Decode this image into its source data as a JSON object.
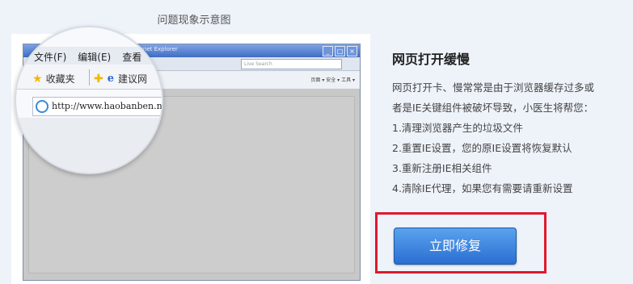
{
  "preview": {
    "caption": "问题现象示意图",
    "ie_title": "ws Internet Explorer",
    "search_placeholder": "Live Search",
    "toolbar_tools": "页面 ▾  安全 ▾  工具 ▾",
    "magnifier": {
      "menu_file": "文件(F)",
      "menu_edit": "编辑(E)",
      "menu_view": "查看",
      "favorites_label": "收藏夹",
      "suggest_label": "建议网",
      "url": "http://www.haobanben.ne"
    }
  },
  "panel": {
    "title": "网页打开缓慢",
    "description": [
      "网页打开卡、慢常常是由于浏览器缓存过多或",
      "者是IE关键组件被破坏导致，小医生将帮您：",
      "1.清理浏览器产生的垃圾文件",
      "2.重置IE设置，您的原IE设置将恢复默认",
      "3.重新注册IE相关组件",
      "4.清除IE代理，如果您有需要请重新设置"
    ],
    "fix_button_label": "立即修复"
  },
  "colors": {
    "button_top": "#5aa3ee",
    "button_bottom": "#2a6ed2",
    "highlight": "#e0192d"
  }
}
